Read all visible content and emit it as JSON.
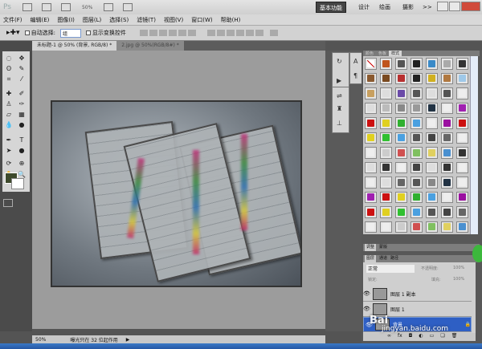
{
  "app": {
    "logo": "Ps",
    "zoom": "50%"
  },
  "workspaces": [
    "基本功能",
    "设计",
    "绘画",
    "摄影",
    ">>"
  ],
  "menu": [
    "文件(F)",
    "编辑(E)",
    "图像(I)",
    "图层(L)",
    "选择(S)",
    "滤镜(T)",
    "视图(V)",
    "窗口(W)",
    "帮助(H)"
  ],
  "options": {
    "auto_select_label": "自动选择:",
    "auto_select_value": "组",
    "show_transform_label": "显示变换控件"
  },
  "tabs": [
    {
      "label": "未标题-1 @ 50% (背景, RGB/8) *"
    },
    {
      "label": "2.jpg @ 50%(RGB/8#) *"
    }
  ],
  "colors": {
    "foreground": "#3e4a2c",
    "background": "#ffffff",
    "accent": "#2e5fc4"
  },
  "styles_panel": {
    "tabs": [
      "颜色",
      "色板",
      "样式"
    ],
    "swatches": [
      "none",
      "#c0541c",
      "#555555",
      "#222222",
      "#3a8ac8",
      "#aaaaaa",
      "#333333",
      "#8a5a30",
      "#7a4a20",
      "#b83030",
      "#222222",
      "#d0b020",
      "#b07840",
      "#9ec8e8",
      "#c8a060",
      "#dddddd",
      "#6a4aa8",
      "#555555",
      "#dddddd",
      "#555555",
      "#eeeeee",
      "#dddddd",
      "#bbbbbb",
      "#888888",
      "#999999",
      "#223344",
      "#eeeeee",
      "#a020b0",
      "#cc1010",
      "#e0d020",
      "#30b030",
      "#4aa0e0",
      "#eeeeee",
      "#9a10a0",
      "#cc1010",
      "#e0d020",
      "#30c030",
      "#4aa0e0",
      "#555555",
      "#444444",
      "#666666",
      "#eeeeee",
      "#eeeeee",
      "#cccccc",
      "#d05050",
      "#80c060",
      "#e0d060",
      "#4a90d0",
      "#333333",
      "#dddddd",
      "#333333",
      "#eeeeee",
      "#444444",
      "#dddddd",
      "#333333",
      "#eeeeee",
      "#eeeeee",
      "#dddddd",
      "#666666",
      "#555555",
      "#888888",
      "#223344",
      "#eeeeee",
      "#a020b0",
      "#cc1010",
      "#e0d020",
      "#30b030",
      "#4aa0e0",
      "#eeeeee",
      "#9a10a0",
      "#cc1010",
      "#e0d020",
      "#30c030",
      "#4aa0e0",
      "#555555",
      "#444444",
      "#666666",
      "#eeeeee",
      "#eeeeee",
      "#cccccc",
      "#d05050",
      "#80c060",
      "#e0d060",
      "#4a90d0"
    ]
  },
  "adjust_tabs": [
    "调整",
    "蒙版"
  ],
  "layers_panel": {
    "tabs": [
      "图层",
      "通道",
      "路径"
    ],
    "blend_mode": "正常",
    "opacity_label": "不透明度:",
    "opacity": "100%",
    "lock_label": "锁定:",
    "fill_label": "填充:",
    "fill": "100%",
    "layers": [
      {
        "name": "图层 1 副本"
      },
      {
        "name": "图层 1"
      },
      {
        "name": "背景"
      }
    ]
  },
  "status": {
    "zoom": "50%",
    "info": "曝光只在 32 位起作用"
  },
  "watermark": {
    "line1": "Bai",
    "line2": "jingyan.baidu.com"
  }
}
